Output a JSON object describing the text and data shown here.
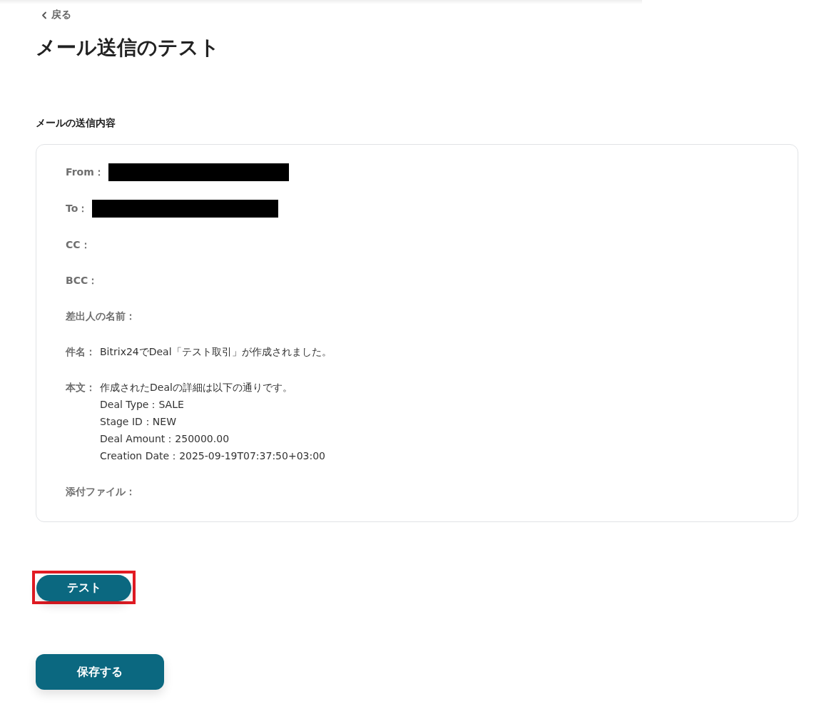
{
  "back_link": {
    "label": "戻る"
  },
  "title": "メール送信のテスト",
  "section_label": "メールの送信内容",
  "fields": [
    {
      "label": "From：",
      "kind": "redacted"
    },
    {
      "label": "To：",
      "kind": "redacted"
    },
    {
      "label": "CC：",
      "kind": "empty"
    },
    {
      "label": "BCC：",
      "kind": "empty"
    },
    {
      "label": "差出人の名前：",
      "kind": "empty"
    },
    {
      "label": "件名：",
      "kind": "text",
      "lines": [
        "Bitrix24でDeal「テスト取引」が作成されました。"
      ]
    },
    {
      "label": "本文：",
      "kind": "text",
      "lines": [
        "作成されたDealの詳細は以下の通りです。",
        "Deal Type：SALE",
        "Stage ID：NEW",
        "Deal Amount：250000.00",
        "Creation Date：2025-09-19T07:37:50+03:00"
      ]
    },
    {
      "label": "添付ファイル：",
      "kind": "empty"
    }
  ],
  "buttons": [
    {
      "label": "テスト",
      "kind": "pill",
      "highlighted": true
    },
    {
      "label": "保存する",
      "kind": "block",
      "highlighted": false
    }
  ]
}
